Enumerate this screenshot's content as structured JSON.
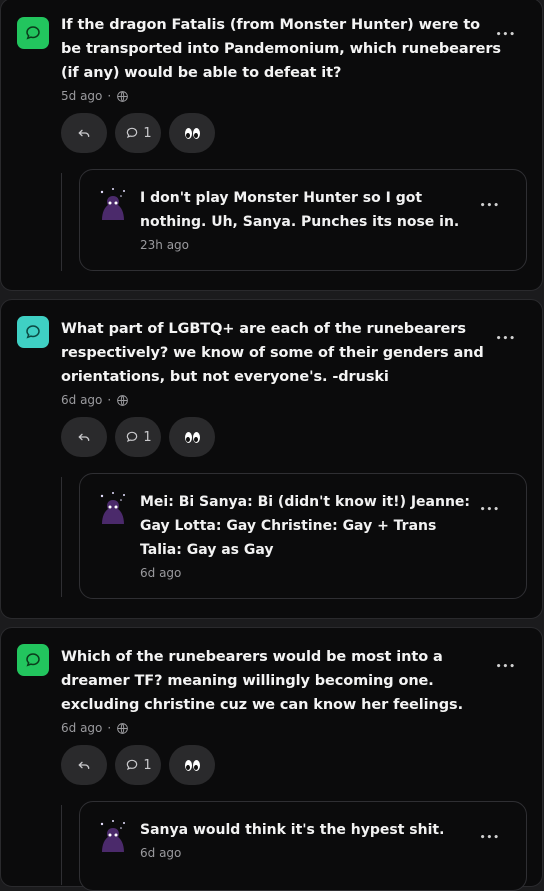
{
  "colors": {
    "ask_green": "#22c55e",
    "ask_teal": "#3fd0c4",
    "background": "#0b0b0c",
    "pill": "#2a2a2c"
  },
  "posts": [
    {
      "question": "If the dragon Fatalis (from Monster Hunter) were to be transported into Pandemonium, which runebearers (if any) would be able to defeat it?",
      "time": "5d ago",
      "dot": "·",
      "comment_count": "1",
      "more": "•••",
      "reply": {
        "text": "I don't play Monster Hunter so I got nothing. Uh, Sanya. Punches its nose in.",
        "time": "23h ago",
        "more": "•••"
      }
    },
    {
      "question": "What part of LGBTQ+ are each of the runebearers respectively? we know of some of their genders and orientations, but not everyone's. -druski",
      "time": "6d ago",
      "dot": "·",
      "comment_count": "1",
      "more": "•••",
      "reply": {
        "text": "Mei: Bi Sanya: Bi (didn't know it!) Jeanne: Gay Lotta: Gay Christine: Gay + Trans Talia: Gay as Gay",
        "time": "6d ago",
        "more": "•••"
      }
    },
    {
      "question": "Which of the runebearers would be most into a dreamer TF? meaning willingly becoming one. excluding christine cuz we can know her feelings.",
      "time": "6d ago",
      "dot": "·",
      "comment_count": "1",
      "more": "•••",
      "reply": {
        "text": "Sanya would think it's the hypest shit.",
        "time": "6d ago",
        "more": "•••"
      }
    }
  ]
}
